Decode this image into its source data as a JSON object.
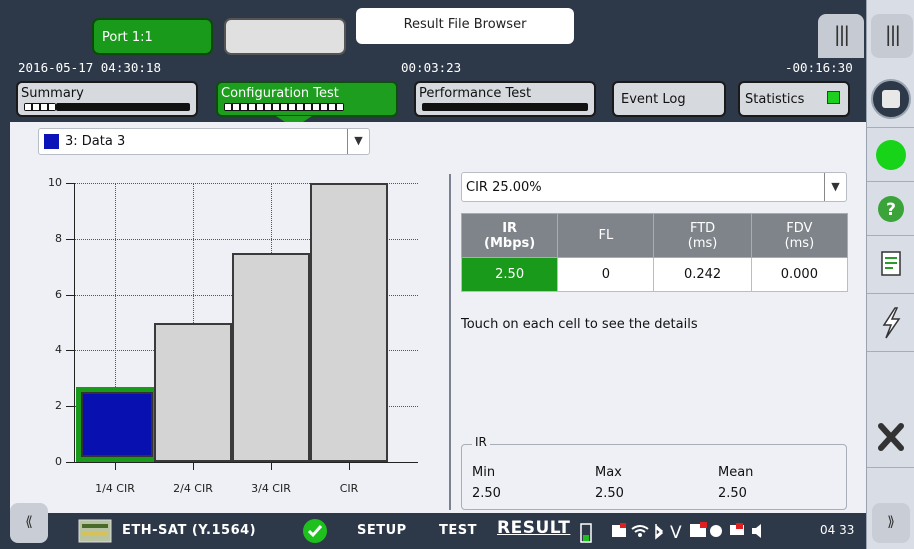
{
  "header": {
    "port_label": "Port 1:1",
    "result_file_browser": "Result File Browser",
    "datetime": "2016-05-17 04:30:18",
    "elapsed": "00:03:23",
    "remaining": "-00:16:30",
    "tabs": [
      {
        "label": "Summary"
      },
      {
        "label": "Configuration Test"
      },
      {
        "label": "Performance Test"
      },
      {
        "label": "Event Log"
      },
      {
        "label": "Statistics"
      }
    ]
  },
  "main": {
    "service_select": "3: Data 3",
    "step_select": "CIR 25.00%",
    "table": {
      "headers": [
        {
          "line1": "IR",
          "line2": "(Mbps)"
        },
        {
          "line1": "FL",
          "line2": ""
        },
        {
          "line1": "FTD",
          "line2": "(ms)"
        },
        {
          "line1": "FDV",
          "line2": "(ms)"
        }
      ],
      "row": [
        "2.50",
        "0",
        "0.242",
        "0.000"
      ]
    },
    "hint": "Touch on each cell to see the details",
    "ir_summary": {
      "legend": "IR",
      "min_label": "Min",
      "max_label": "Max",
      "mean_label": "Mean",
      "min": "2.50",
      "max": "2.50",
      "mean": "2.50"
    }
  },
  "chart_data": {
    "type": "bar",
    "categories": [
      "1/4 CIR",
      "2/4 CIR",
      "3/4 CIR",
      "CIR"
    ],
    "values": [
      2.5,
      5,
      7.5,
      10
    ],
    "selected_index": 0,
    "ylim": [
      0,
      10
    ],
    "yticks": [
      "0",
      "2",
      "4",
      "6",
      "8",
      "10"
    ],
    "selected_color": "#0810b0",
    "bar_color": "#d4d4d4"
  },
  "bottom": {
    "app_name": "ETH-SAT (Y.1564)",
    "setup": "SETUP",
    "test": "TEST",
    "result": "RESULT",
    "clock": "04 33"
  },
  "icons": {
    "sidebar": [
      "stop-icon",
      "status-led-icon",
      "help-icon",
      "report-icon",
      "inject-error-icon",
      "close-icon"
    ]
  }
}
